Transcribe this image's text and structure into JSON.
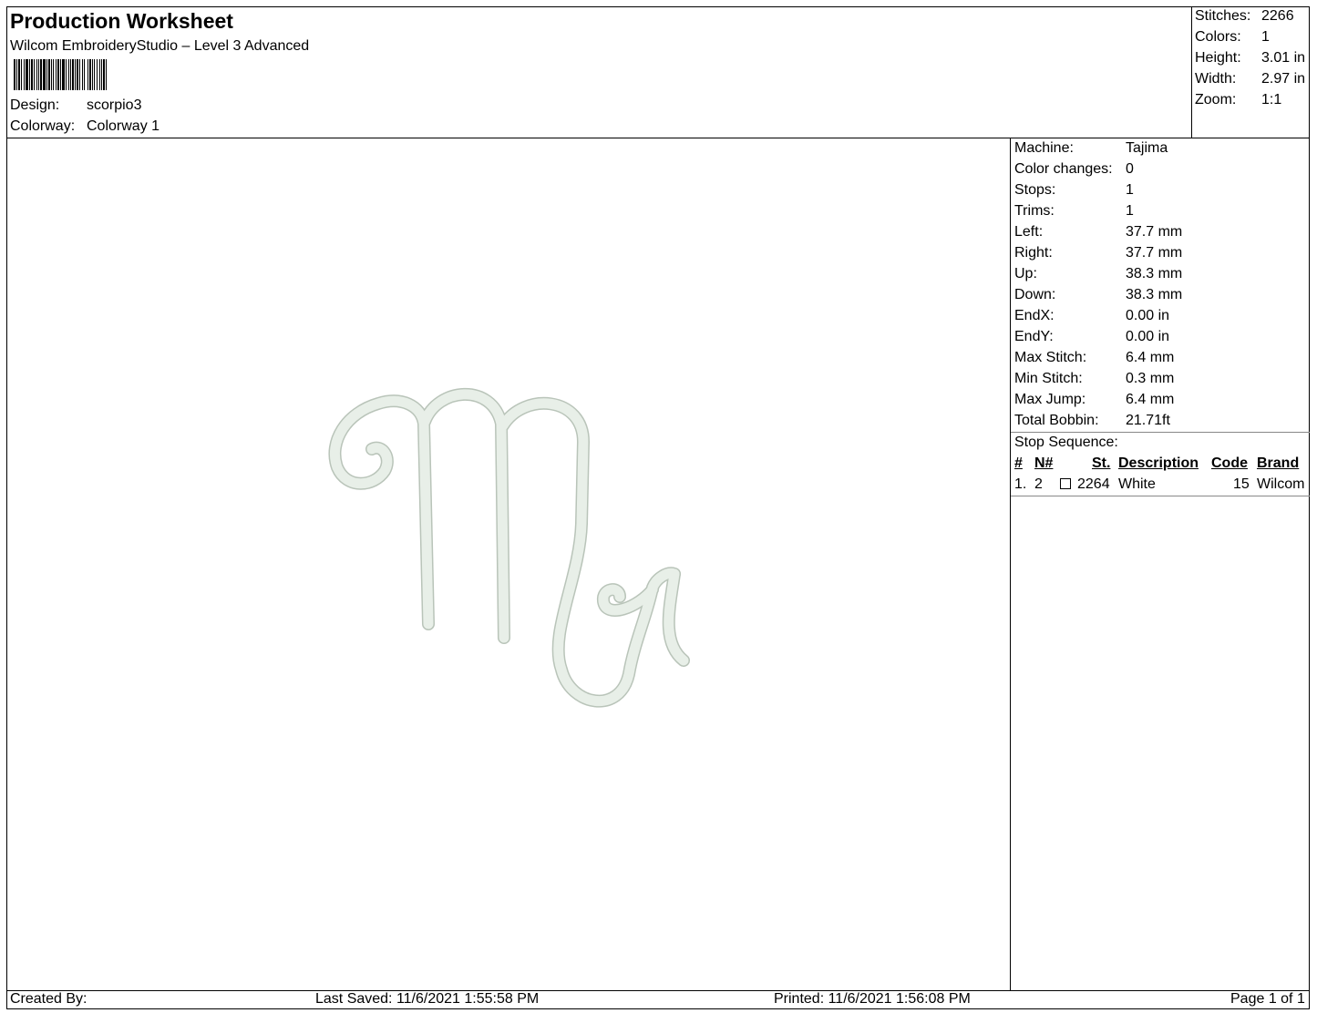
{
  "header": {
    "title": "Production Worksheet",
    "subtitle": "Wilcom EmbroideryStudio – Level 3 Advanced",
    "design_label": "Design:",
    "design_value": "scorpio3",
    "colorway_label": "Colorway:",
    "colorway_value": "Colorway 1"
  },
  "summary": [
    {
      "label": "Stitches:",
      "value": "2266"
    },
    {
      "label": "Colors:",
      "value": "1"
    },
    {
      "label": "Height:",
      "value": "3.01 in"
    },
    {
      "label": "Width:",
      "value": "2.97 in"
    },
    {
      "label": "Zoom:",
      "value": "1:1"
    }
  ],
  "details": [
    {
      "label": "Machine:",
      "value": "Tajima"
    },
    {
      "label": "Color changes:",
      "value": "0"
    },
    {
      "label": "Stops:",
      "value": "1"
    },
    {
      "label": "Trims:",
      "value": "1"
    },
    {
      "label": "Left:",
      "value": "37.7 mm"
    },
    {
      "label": "Right:",
      "value": "37.7 mm"
    },
    {
      "label": "Up:",
      "value": "38.3 mm"
    },
    {
      "label": "Down:",
      "value": "38.3 mm"
    },
    {
      "label": "EndX:",
      "value": "0.00 in"
    },
    {
      "label": "EndY:",
      "value": "0.00 in"
    },
    {
      "label": "Max Stitch:",
      "value": "6.4 mm"
    },
    {
      "label": "Min Stitch:",
      "value": "0.3 mm"
    },
    {
      "label": "Max Jump:",
      "value": "6.4 mm"
    },
    {
      "label": "Total Bobbin:",
      "value": "21.71ft"
    }
  ],
  "stop_sequence": {
    "label": "Stop Sequence:",
    "columns": [
      "#",
      "N#",
      "St.",
      "Description",
      "Code",
      "Brand"
    ],
    "rows": [
      {
        "num": "1.",
        "n": "2",
        "st": "2264",
        "description": "White",
        "code": "15",
        "brand": "Wilcom",
        "swatch_color": "#ffffff"
      }
    ]
  },
  "design_color": "#e8efe8",
  "design_edge_color": "#b9c4b9",
  "footer": {
    "created_by": "Created By:",
    "last_saved": "Last Saved: 11/6/2021 1:55:58 PM",
    "printed": "Printed: 11/6/2021 1:56:08 PM",
    "page": "Page 1 of 1"
  }
}
